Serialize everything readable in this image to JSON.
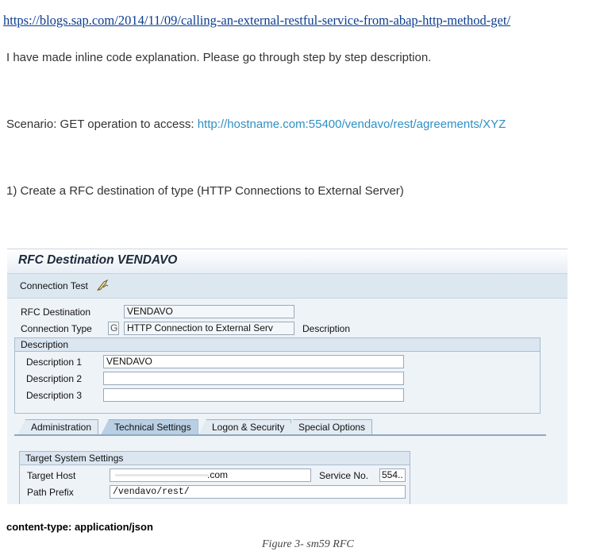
{
  "blog_link": "https://blogs.sap.com/2014/11/09/calling-an-external-restful-service-from-abap-http-method-get/",
  "intro": "I have made inline code explanation. Please go through step by step description.",
  "scenario": {
    "prefix": "Scenario: GET operation to access: ",
    "url": "http://hostname.com:55400/vendavo/rest/agreements/XYZ"
  },
  "step1": "1) Create a RFC destination of type (HTTP Connections to External Server)",
  "sap": {
    "title": "RFC Destination VENDAVO",
    "toolbar": {
      "connection_test": "Connection Test"
    },
    "rfc_destination_label": "RFC Destination",
    "rfc_destination_value": "VENDAVO",
    "connection_type_label": "Connection Type",
    "connection_type_code": "G",
    "connection_type_value": "HTTP Connection to External Serv",
    "connection_type_desc": "Description",
    "description_group": {
      "title": "Description",
      "rows": [
        {
          "label": "Description 1",
          "value": "VENDAVO"
        },
        {
          "label": "Description 2",
          "value": ""
        },
        {
          "label": "Description 3",
          "value": ""
        }
      ]
    },
    "tabs": [
      "Administration",
      "Technical Settings",
      "Logon & Security",
      "Special Options"
    ],
    "active_tab": "Technical Settings",
    "target_group": {
      "title": "Target System Settings",
      "target_host_label": "Target Host",
      "target_host_value": ".com",
      "service_no_label": "Service No.",
      "service_no_value": "554..",
      "path_prefix_label": "Path Prefix",
      "path_prefix_value": "/vendavo/rest/"
    }
  },
  "content_type": "content-type: application/json",
  "caption": "Figure 3- sm59 RFC"
}
